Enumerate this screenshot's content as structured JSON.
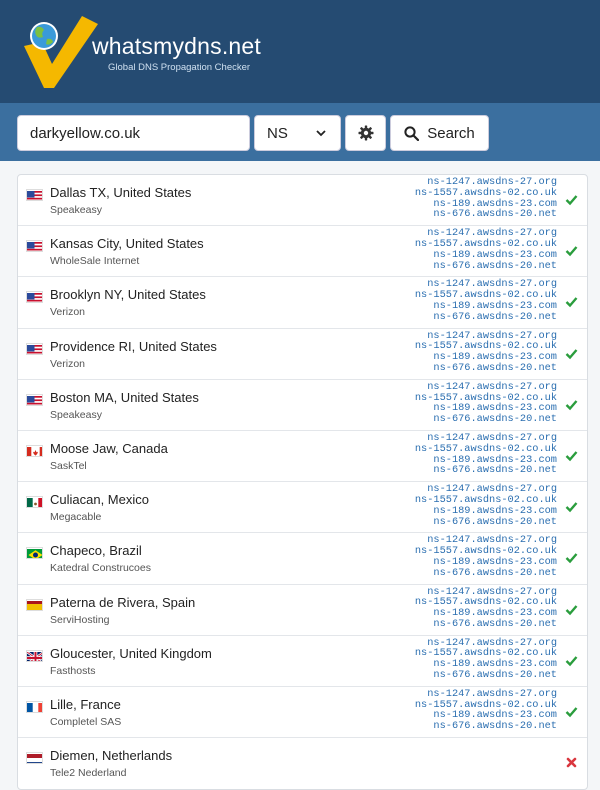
{
  "brand": {
    "name": "whatsmydns.net",
    "tagline": "Global DNS Propagation Checker"
  },
  "search": {
    "domain": "darkyellow.co.uk",
    "record_type": "NS",
    "search_label": "Search"
  },
  "colors": {
    "header": "#254b72",
    "searchbar": "#3b6f9f",
    "link": "#2a6eb0",
    "ok": "#2a9d3d",
    "fail": "#d9363e"
  },
  "results": [
    {
      "location": "Dallas TX, United States",
      "provider": "Speakeasy",
      "flag": "us",
      "status": "ok",
      "ns": [
        "ns-1247.awsdns-27.org",
        "ns-1557.awsdns-02.co.uk",
        "ns-189.awsdns-23.com",
        "ns-676.awsdns-20.net"
      ]
    },
    {
      "location": "Kansas City, United States",
      "provider": "WholeSale Internet",
      "flag": "us",
      "status": "ok",
      "ns": [
        "ns-1247.awsdns-27.org",
        "ns-1557.awsdns-02.co.uk",
        "ns-189.awsdns-23.com",
        "ns-676.awsdns-20.net"
      ]
    },
    {
      "location": "Brooklyn NY, United States",
      "provider": "Verizon",
      "flag": "us",
      "status": "ok",
      "ns": [
        "ns-1247.awsdns-27.org",
        "ns-1557.awsdns-02.co.uk",
        "ns-189.awsdns-23.com",
        "ns-676.awsdns-20.net"
      ]
    },
    {
      "location": "Providence RI, United States",
      "provider": "Verizon",
      "flag": "us",
      "status": "ok",
      "ns": [
        "ns-1247.awsdns-27.org",
        "ns-1557.awsdns-02.co.uk",
        "ns-189.awsdns-23.com",
        "ns-676.awsdns-20.net"
      ]
    },
    {
      "location": "Boston MA, United States",
      "provider": "Speakeasy",
      "flag": "us",
      "status": "ok",
      "ns": [
        "ns-1247.awsdns-27.org",
        "ns-1557.awsdns-02.co.uk",
        "ns-189.awsdns-23.com",
        "ns-676.awsdns-20.net"
      ]
    },
    {
      "location": "Moose Jaw, Canada",
      "provider": "SaskTel",
      "flag": "ca",
      "status": "ok",
      "ns": [
        "ns-1247.awsdns-27.org",
        "ns-1557.awsdns-02.co.uk",
        "ns-189.awsdns-23.com",
        "ns-676.awsdns-20.net"
      ]
    },
    {
      "location": "Culiacan, Mexico",
      "provider": "Megacable",
      "flag": "mx",
      "status": "ok",
      "ns": [
        "ns-1247.awsdns-27.org",
        "ns-1557.awsdns-02.co.uk",
        "ns-189.awsdns-23.com",
        "ns-676.awsdns-20.net"
      ]
    },
    {
      "location": "Chapeco, Brazil",
      "provider": "Katedral Construcoes",
      "flag": "br",
      "status": "ok",
      "ns": [
        "ns-1247.awsdns-27.org",
        "ns-1557.awsdns-02.co.uk",
        "ns-189.awsdns-23.com",
        "ns-676.awsdns-20.net"
      ]
    },
    {
      "location": "Paterna de Rivera, Spain",
      "provider": "ServiHosting",
      "flag": "es",
      "status": "ok",
      "ns": [
        "ns-1247.awsdns-27.org",
        "ns-1557.awsdns-02.co.uk",
        "ns-189.awsdns-23.com",
        "ns-676.awsdns-20.net"
      ]
    },
    {
      "location": "Gloucester, United Kingdom",
      "provider": "Fasthosts",
      "flag": "gb",
      "status": "ok",
      "ns": [
        "ns-1247.awsdns-27.org",
        "ns-1557.awsdns-02.co.uk",
        "ns-189.awsdns-23.com",
        "ns-676.awsdns-20.net"
      ]
    },
    {
      "location": "Lille, France",
      "provider": "Completel SAS",
      "flag": "fr",
      "status": "ok",
      "ns": [
        "ns-1247.awsdns-27.org",
        "ns-1557.awsdns-02.co.uk",
        "ns-189.awsdns-23.com",
        "ns-676.awsdns-20.net"
      ]
    },
    {
      "location": "Diemen, Netherlands",
      "provider": "Tele2 Nederland",
      "flag": "nl",
      "status": "fail",
      "ns": []
    }
  ]
}
